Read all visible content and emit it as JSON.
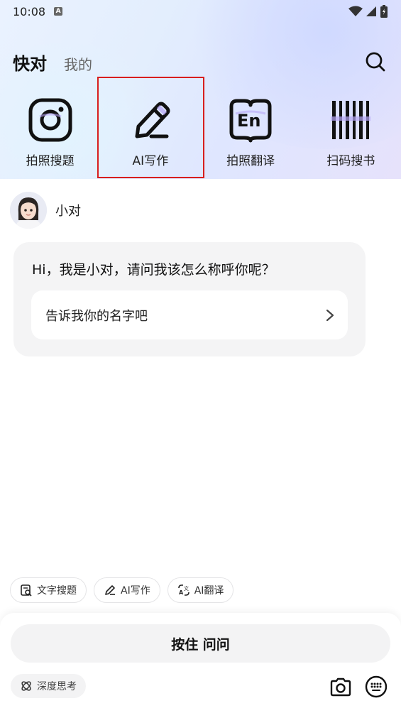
{
  "status_bar": {
    "time": "10:08",
    "app_icon_letter": "A"
  },
  "header": {
    "active_tab": "快对",
    "inactive_tab": "我的"
  },
  "tools": [
    {
      "label": "拍照搜题",
      "icon": "instagram-camera-icon"
    },
    {
      "label": "AI写作",
      "icon": "pencil-icon"
    },
    {
      "label": "拍照翻译",
      "icon": "en-book-icon"
    },
    {
      "label": "扫码搜书",
      "icon": "barcode-icon"
    }
  ],
  "chat": {
    "assistant_name": "小对",
    "greeting": "Hi，我是小对，请问我该怎么称呼你呢？",
    "suggestion": "告诉我你的名字吧"
  },
  "chips": [
    {
      "label": "文字搜题",
      "icon": "text-search-icon"
    },
    {
      "label": "AI写作",
      "icon": "pencil-icon"
    },
    {
      "label": "AI翻译",
      "icon": "translate-icon"
    }
  ],
  "bottom": {
    "hold_to_ask": "按住 问问",
    "deep_think": "深度思考"
  },
  "colors": {
    "highlight_border": "#d81e1e",
    "accent_purple": "#b7a6f5"
  }
}
